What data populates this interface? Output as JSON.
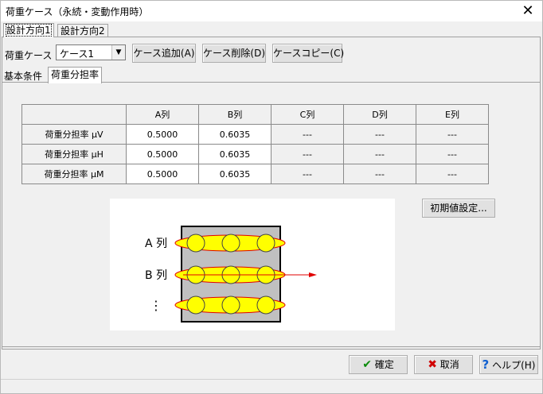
{
  "window": {
    "title": "荷重ケース（永続・変動作用時）"
  },
  "direction_tabs": [
    {
      "label": "設計方向1",
      "active": true
    },
    {
      "label": "設計方向2",
      "active": false
    }
  ],
  "case_row": {
    "label": "荷重ケース",
    "selected": "ケース1",
    "add_button": "ケース追加(A)",
    "delete_button": "ケース削除(D)",
    "copy_button": "ケースコピー(C)"
  },
  "sub_tabs": [
    {
      "label": "基本条件",
      "active": false
    },
    {
      "label": "荷重分担率",
      "active": true
    }
  ],
  "table": {
    "columns": [
      "A列",
      "B列",
      "C列",
      "D列",
      "E列"
    ],
    "rows": [
      {
        "label": "荷重分担率 μV",
        "values": [
          "0.5000",
          "0.6035",
          "---",
          "---",
          "---"
        ]
      },
      {
        "label": "荷重分担率 μH",
        "values": [
          "0.5000",
          "0.6035",
          "---",
          "---",
          "---"
        ]
      },
      {
        "label": "荷重分担率 μM",
        "values": [
          "0.5000",
          "0.6035",
          "---",
          "---",
          "---"
        ]
      }
    ]
  },
  "init_button": "初期値設定...",
  "diagram": {
    "row_a": "A 列",
    "row_b": "B 列",
    "row_more": "⋮",
    "colors": {
      "ellipse": "#ffff00",
      "outline": "#e00000",
      "block": "#c0c0c0"
    }
  },
  "footer": {
    "ok": "確定",
    "cancel": "取消",
    "help": "ヘルプ(H)"
  },
  "icons": {
    "ok": "check-icon",
    "cancel": "x-icon",
    "help": "question-icon",
    "close": "close-icon"
  }
}
